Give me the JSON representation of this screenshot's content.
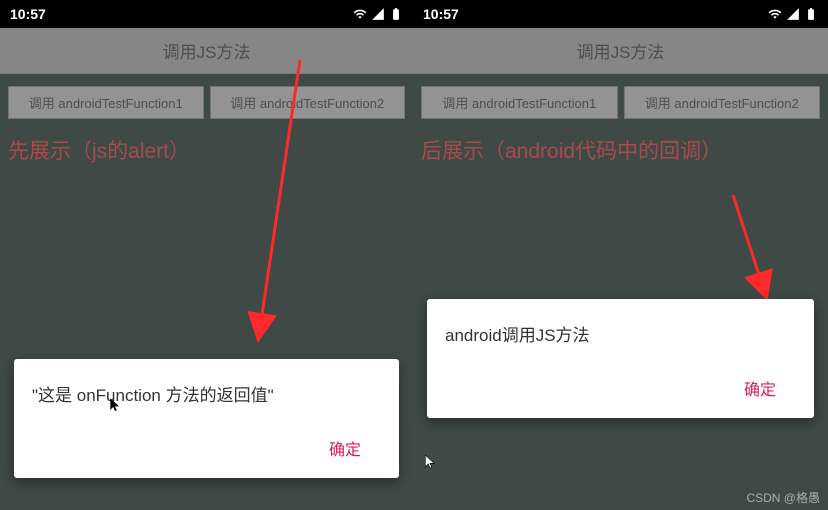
{
  "statusBar": {
    "time": "10:57"
  },
  "app": {
    "title": "调用JS方法",
    "button1_label": "调用 androidTestFunction1",
    "button2_label": "调用 androidTestFunction2"
  },
  "left": {
    "annotation": "先展示（js的alert）",
    "dialog": {
      "message": "\"这是 onFunction 方法的返回值\"",
      "confirm_label": "确定"
    }
  },
  "right": {
    "annotation": "后展示（android代码中的回调）",
    "dialog": {
      "message": "android调用JS方法",
      "confirm_label": "确定"
    }
  },
  "watermark": "CSDN @格愚"
}
